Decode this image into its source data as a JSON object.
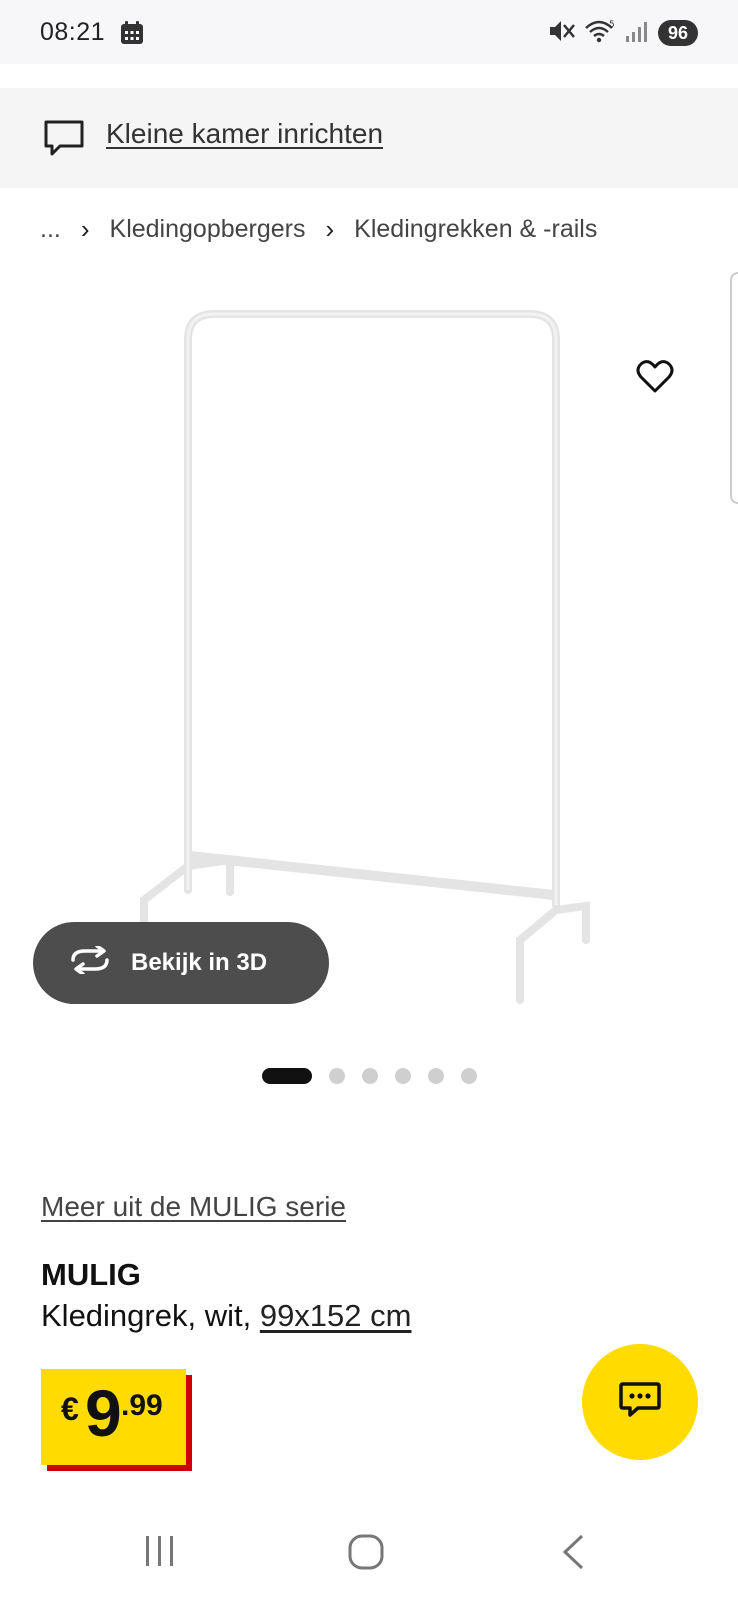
{
  "status_bar": {
    "time": "08:21",
    "battery": "96",
    "icons": [
      "calendar-icon",
      "mute-icon",
      "wifi-icon",
      "signal-icon"
    ]
  },
  "banner": {
    "icon": "chat-bubble-icon",
    "link_text": "Kleine kamer inrichten"
  },
  "breadcrumb": {
    "ellipsis": "...",
    "items": [
      "Kledingopbergers",
      "Kledingrekken & -rails"
    ]
  },
  "gallery": {
    "image_count": 6,
    "active_index": 0,
    "view3d_label": "Bekijk in 3D"
  },
  "product": {
    "series_link": "Meer uit de MULIG serie",
    "name": "MULIG",
    "desc_prefix": "Kledingrek, wit, ",
    "dimensions": "99x152 cm",
    "price": {
      "currency": "€",
      "integer": "9",
      "decimal": ".99"
    }
  },
  "colors": {
    "accent_yellow": "#ffdb00",
    "price_shadow_red": "#cc0008",
    "dark_button": "#4d4d4d"
  },
  "nav": {
    "buttons": [
      "recent-apps-icon",
      "home-icon",
      "back-icon"
    ]
  }
}
